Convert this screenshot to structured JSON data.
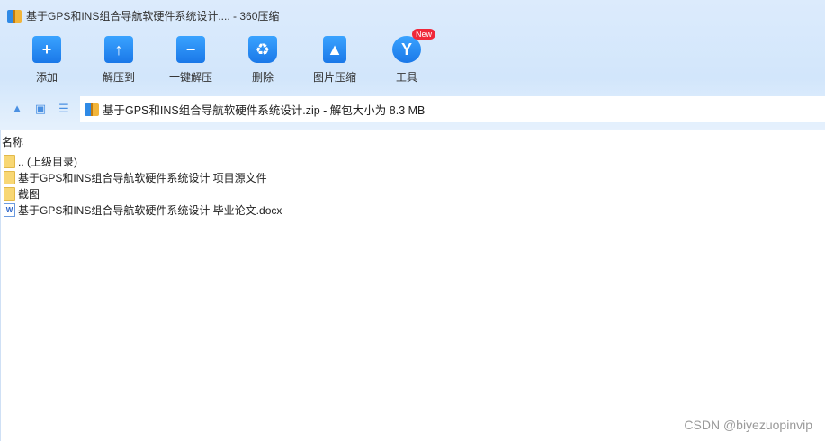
{
  "window": {
    "title": "基于GPS和INS组合导航软硬件系统设计.... - 360压缩"
  },
  "toolbar": [
    {
      "label": "添加",
      "icon": "+"
    },
    {
      "label": "解压到",
      "icon": "↑"
    },
    {
      "label": "一键解压",
      "icon": "−"
    },
    {
      "label": "删除",
      "icon": "♻"
    },
    {
      "label": "图片压缩",
      "icon": "▲"
    },
    {
      "label": "工具",
      "icon": "Y",
      "badge": "New"
    }
  ],
  "address": {
    "text": "基于GPS和INS组合导航软硬件系统设计.zip - 解包大小为 8.3 MB"
  },
  "list": {
    "column": "名称",
    "items": [
      {
        "name": ".. (上级目录)",
        "type": "folder"
      },
      {
        "name": "基于GPS和INS组合导航软硬件系统设计 项目源文件",
        "type": "folder"
      },
      {
        "name": "截图",
        "type": "folder"
      },
      {
        "name": "基于GPS和INS组合导航软硬件系统设计 毕业论文.docx",
        "type": "docx"
      }
    ]
  },
  "watermark": "CSDN @biyezuopinvip"
}
